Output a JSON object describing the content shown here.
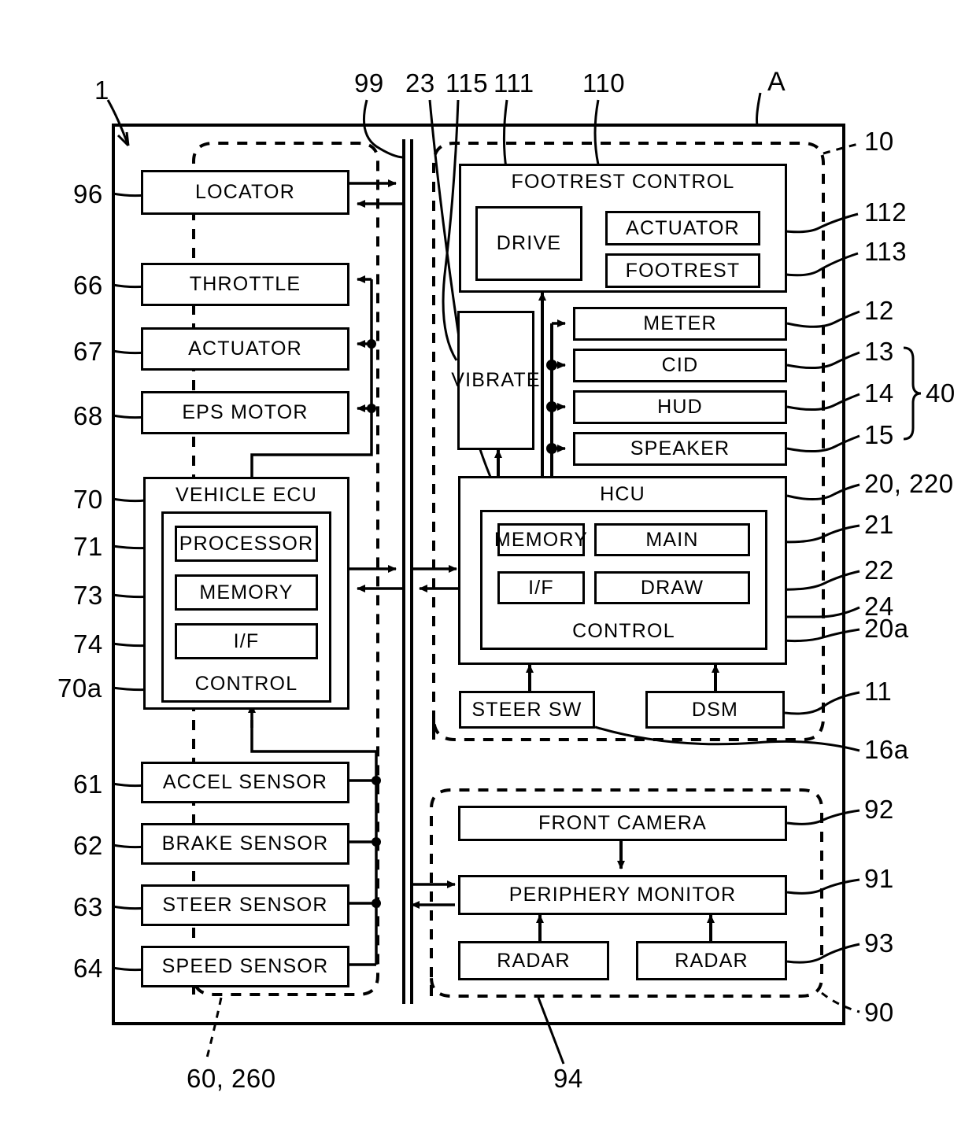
{
  "figure": {
    "title_label": "A",
    "outer_ref": "1"
  },
  "left_group": {
    "ref_bottom": "60, 260",
    "boxes": [
      {
        "label": "LOCATOR",
        "ref": "96"
      },
      {
        "label": "THROTTLE",
        "ref": "66"
      },
      {
        "label": "ACTUATOR",
        "ref": "67"
      },
      {
        "label": "EPS MOTOR",
        "ref": "68"
      },
      {
        "label": "ACCEL SENSOR",
        "ref": "61"
      },
      {
        "label": "BRAKE SENSOR",
        "ref": "62"
      },
      {
        "label": "STEER SENSOR",
        "ref": "63"
      },
      {
        "label": "SPEED SENSOR",
        "ref": "64"
      }
    ],
    "vehicle_ecu": {
      "title": "VEHICLE ECU",
      "ref": "70",
      "control_label": "CONTROL",
      "control_ref": "70a",
      "items": [
        {
          "label": "PROCESSOR",
          "ref": "71"
        },
        {
          "label": "MEMORY",
          "ref": "73"
        },
        {
          "label": "I/F",
          "ref": "74"
        }
      ]
    }
  },
  "bus": {
    "ref": "99"
  },
  "hmi_group": {
    "ref": "10",
    "ref_bottom": "16a",
    "footrest_control": {
      "title": "FOOTREST CONTROL",
      "ref": "110",
      "drive": {
        "label": "DRIVE",
        "ref": "111"
      },
      "actuator": {
        "label": "ACTUATOR",
        "ref": "112"
      },
      "footrest": {
        "label": "FOOTREST",
        "ref": "113"
      }
    },
    "vibrate": {
      "label": "VIBRATE",
      "ref": "115"
    },
    "devices": {
      "brace_ref": "40",
      "items": [
        {
          "label": "METER",
          "ref": "12"
        },
        {
          "label": "CID",
          "ref": "13"
        },
        {
          "label": "HUD",
          "ref": "14"
        },
        {
          "label": "SPEAKER",
          "ref": "15"
        }
      ]
    },
    "hcu": {
      "title": "HCU",
      "ref": "20, 220",
      "control_label": "CONTROL",
      "control_ref": "20a",
      "memory": {
        "label": "MEMORY",
        "ref": "23"
      },
      "main": {
        "label": "MAIN",
        "ref": "21"
      },
      "iface": {
        "label": "I/F",
        "ref": "24"
      },
      "draw": {
        "label": "DRAW",
        "ref": "22"
      }
    },
    "steer_sw": {
      "label": "STEER SW"
    },
    "dsm": {
      "label": "DSM",
      "ref": "11"
    }
  },
  "periphery_group": {
    "ref": "90",
    "ref_bottom": "94",
    "front_camera": {
      "label": "FRONT CAMERA",
      "ref": "92"
    },
    "monitor": {
      "label": "PERIPHERY MONITOR",
      "ref": "91"
    },
    "radar_left": {
      "label": "RADAR"
    },
    "radar_right": {
      "label": "RADAR",
      "ref": "93"
    }
  }
}
